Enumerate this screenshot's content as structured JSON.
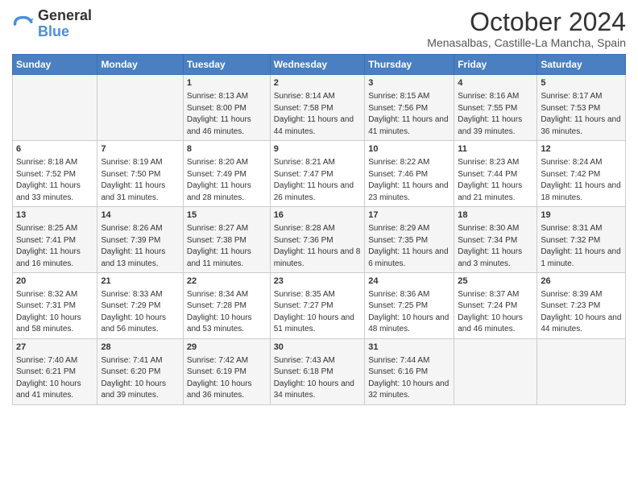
{
  "header": {
    "logo_line1": "General",
    "logo_line2": "Blue",
    "title": "October 2024",
    "subtitle": "Menasalbas, Castille-La Mancha, Spain"
  },
  "columns": [
    "Sunday",
    "Monday",
    "Tuesday",
    "Wednesday",
    "Thursday",
    "Friday",
    "Saturday"
  ],
  "weeks": [
    [
      {
        "day": "",
        "sunrise": "",
        "sunset": "",
        "daylight": ""
      },
      {
        "day": "",
        "sunrise": "",
        "sunset": "",
        "daylight": ""
      },
      {
        "day": "1",
        "sunrise": "Sunrise: 8:13 AM",
        "sunset": "Sunset: 8:00 PM",
        "daylight": "Daylight: 11 hours and 46 minutes."
      },
      {
        "day": "2",
        "sunrise": "Sunrise: 8:14 AM",
        "sunset": "Sunset: 7:58 PM",
        "daylight": "Daylight: 11 hours and 44 minutes."
      },
      {
        "day": "3",
        "sunrise": "Sunrise: 8:15 AM",
        "sunset": "Sunset: 7:56 PM",
        "daylight": "Daylight: 11 hours and 41 minutes."
      },
      {
        "day": "4",
        "sunrise": "Sunrise: 8:16 AM",
        "sunset": "Sunset: 7:55 PM",
        "daylight": "Daylight: 11 hours and 39 minutes."
      },
      {
        "day": "5",
        "sunrise": "Sunrise: 8:17 AM",
        "sunset": "Sunset: 7:53 PM",
        "daylight": "Daylight: 11 hours and 36 minutes."
      }
    ],
    [
      {
        "day": "6",
        "sunrise": "Sunrise: 8:18 AM",
        "sunset": "Sunset: 7:52 PM",
        "daylight": "Daylight: 11 hours and 33 minutes."
      },
      {
        "day": "7",
        "sunrise": "Sunrise: 8:19 AM",
        "sunset": "Sunset: 7:50 PM",
        "daylight": "Daylight: 11 hours and 31 minutes."
      },
      {
        "day": "8",
        "sunrise": "Sunrise: 8:20 AM",
        "sunset": "Sunset: 7:49 PM",
        "daylight": "Daylight: 11 hours and 28 minutes."
      },
      {
        "day": "9",
        "sunrise": "Sunrise: 8:21 AM",
        "sunset": "Sunset: 7:47 PM",
        "daylight": "Daylight: 11 hours and 26 minutes."
      },
      {
        "day": "10",
        "sunrise": "Sunrise: 8:22 AM",
        "sunset": "Sunset: 7:46 PM",
        "daylight": "Daylight: 11 hours and 23 minutes."
      },
      {
        "day": "11",
        "sunrise": "Sunrise: 8:23 AM",
        "sunset": "Sunset: 7:44 PM",
        "daylight": "Daylight: 11 hours and 21 minutes."
      },
      {
        "day": "12",
        "sunrise": "Sunrise: 8:24 AM",
        "sunset": "Sunset: 7:42 PM",
        "daylight": "Daylight: 11 hours and 18 minutes."
      }
    ],
    [
      {
        "day": "13",
        "sunrise": "Sunrise: 8:25 AM",
        "sunset": "Sunset: 7:41 PM",
        "daylight": "Daylight: 11 hours and 16 minutes."
      },
      {
        "day": "14",
        "sunrise": "Sunrise: 8:26 AM",
        "sunset": "Sunset: 7:39 PM",
        "daylight": "Daylight: 11 hours and 13 minutes."
      },
      {
        "day": "15",
        "sunrise": "Sunrise: 8:27 AM",
        "sunset": "Sunset: 7:38 PM",
        "daylight": "Daylight: 11 hours and 11 minutes."
      },
      {
        "day": "16",
        "sunrise": "Sunrise: 8:28 AM",
        "sunset": "Sunset: 7:36 PM",
        "daylight": "Daylight: 11 hours and 8 minutes."
      },
      {
        "day": "17",
        "sunrise": "Sunrise: 8:29 AM",
        "sunset": "Sunset: 7:35 PM",
        "daylight": "Daylight: 11 hours and 6 minutes."
      },
      {
        "day": "18",
        "sunrise": "Sunrise: 8:30 AM",
        "sunset": "Sunset: 7:34 PM",
        "daylight": "Daylight: 11 hours and 3 minutes."
      },
      {
        "day": "19",
        "sunrise": "Sunrise: 8:31 AM",
        "sunset": "Sunset: 7:32 PM",
        "daylight": "Daylight: 11 hours and 1 minute."
      }
    ],
    [
      {
        "day": "20",
        "sunrise": "Sunrise: 8:32 AM",
        "sunset": "Sunset: 7:31 PM",
        "daylight": "Daylight: 10 hours and 58 minutes."
      },
      {
        "day": "21",
        "sunrise": "Sunrise: 8:33 AM",
        "sunset": "Sunset: 7:29 PM",
        "daylight": "Daylight: 10 hours and 56 minutes."
      },
      {
        "day": "22",
        "sunrise": "Sunrise: 8:34 AM",
        "sunset": "Sunset: 7:28 PM",
        "daylight": "Daylight: 10 hours and 53 minutes."
      },
      {
        "day": "23",
        "sunrise": "Sunrise: 8:35 AM",
        "sunset": "Sunset: 7:27 PM",
        "daylight": "Daylight: 10 hours and 51 minutes."
      },
      {
        "day": "24",
        "sunrise": "Sunrise: 8:36 AM",
        "sunset": "Sunset: 7:25 PM",
        "daylight": "Daylight: 10 hours and 48 minutes."
      },
      {
        "day": "25",
        "sunrise": "Sunrise: 8:37 AM",
        "sunset": "Sunset: 7:24 PM",
        "daylight": "Daylight: 10 hours and 46 minutes."
      },
      {
        "day": "26",
        "sunrise": "Sunrise: 8:39 AM",
        "sunset": "Sunset: 7:23 PM",
        "daylight": "Daylight: 10 hours and 44 minutes."
      }
    ],
    [
      {
        "day": "27",
        "sunrise": "Sunrise: 7:40 AM",
        "sunset": "Sunset: 6:21 PM",
        "daylight": "Daylight: 10 hours and 41 minutes."
      },
      {
        "day": "28",
        "sunrise": "Sunrise: 7:41 AM",
        "sunset": "Sunset: 6:20 PM",
        "daylight": "Daylight: 10 hours and 39 minutes."
      },
      {
        "day": "29",
        "sunrise": "Sunrise: 7:42 AM",
        "sunset": "Sunset: 6:19 PM",
        "daylight": "Daylight: 10 hours and 36 minutes."
      },
      {
        "day": "30",
        "sunrise": "Sunrise: 7:43 AM",
        "sunset": "Sunset: 6:18 PM",
        "daylight": "Daylight: 10 hours and 34 minutes."
      },
      {
        "day": "31",
        "sunrise": "Sunrise: 7:44 AM",
        "sunset": "Sunset: 6:16 PM",
        "daylight": "Daylight: 10 hours and 32 minutes."
      },
      {
        "day": "",
        "sunrise": "",
        "sunset": "",
        "daylight": ""
      },
      {
        "day": "",
        "sunrise": "",
        "sunset": "",
        "daylight": ""
      }
    ]
  ]
}
